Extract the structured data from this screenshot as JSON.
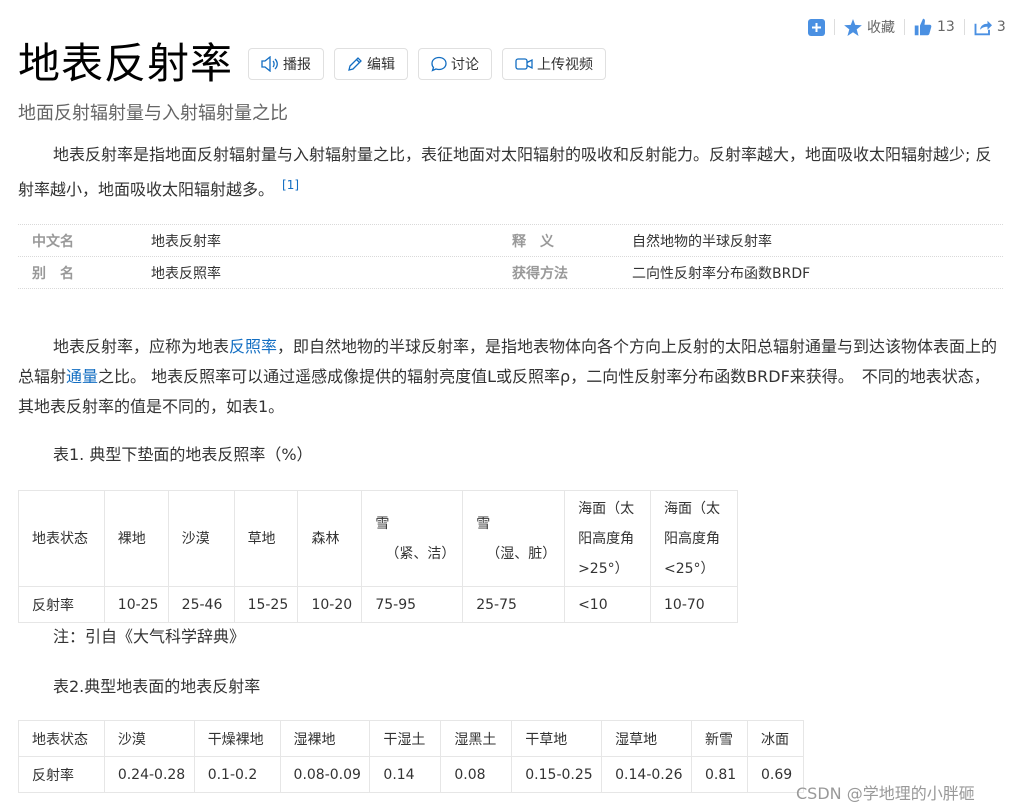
{
  "top_actions": {
    "add_icon": "plus-square-icon",
    "favorite_icon": "star-icon",
    "favorite_label": "收藏",
    "like_icon": "thumbs-up-icon",
    "like_count": "13",
    "share_icon": "share-icon",
    "share_count": "3"
  },
  "header": {
    "title": "地表反射率",
    "buttons": [
      {
        "label": "播报",
        "icon": "speaker-icon"
      },
      {
        "label": "编辑",
        "icon": "pencil-icon"
      },
      {
        "label": "讨论",
        "icon": "comment-icon"
      },
      {
        "label": "上传视频",
        "icon": "video-icon"
      }
    ]
  },
  "subtitle": "地面反射辐射量与入射辐射量之比",
  "summary": {
    "text": "地表反射率是指地面反射辐射量与入射辐射量之比，表征地面对太阳辐射的吸收和反射能力。反射率越大，地面吸收太阳辐射越少; 反射率越小，地面吸收太阳辐射越多。",
    "ref": "[1]"
  },
  "info_box": {
    "rows": [
      {
        "k1": "中文名",
        "v1": "地表反射率",
        "k2": "释　义",
        "v2": "自然地物的半球反射率"
      },
      {
        "k1": "别　名",
        "v1": "地表反照率",
        "k2": "获得方法",
        "v2": "二向性反射率分布函数BRDF"
      }
    ]
  },
  "body": {
    "p1_a": "地表反射率，应称为地表",
    "p1_link1": "反照率",
    "p1_b": "，即自然地物的半球反射率，是指地表物体向各个方向上反射的太阳总辐射通量与到达该物体表面上的总辐射",
    "p1_link2": "通量",
    "p1_c": "之比。 地表反照率可以通过遥感成像提供的辐射亮度值L或反照率ρ，二向性反射率分布函数BRDF来获得。　不同的地表状态，其地表反射率的值是不同的，如表1。"
  },
  "table1": {
    "caption": "表1. 典型下垫面的地表反照率（%）",
    "h0": "地表状态",
    "h1": "裸地",
    "h2": "沙漠",
    "h3": "草地",
    "h4": "森林",
    "h5_a": "雪",
    "h5_b": "（紧、洁）",
    "h6_a": "雪",
    "h6_b": "（湿、脏）",
    "h7_a": "海面（太",
    "h7_b": "阳高度角",
    "h7_c": ">25°）",
    "h8_a": "海面（太",
    "h8_b": "阳高度角",
    "h8_c": "<25°）",
    "row_label": "反射率",
    "values": [
      "10-25",
      "25-46",
      "15-25",
      "10-20",
      "75-95",
      "25-75",
      "<10",
      "10-70"
    ]
  },
  "note": "注：引自《大气科学辞典》",
  "table2": {
    "caption": "表2.典型地表面的地表反射率",
    "headers": [
      "地表状态",
      "沙漠",
      "干燥裸地",
      "湿裸地",
      "干湿土",
      "湿黑土",
      "干草地",
      "湿草地",
      "新雪",
      "冰面"
    ],
    "row_label": "反射率",
    "values": [
      "0.24-0.28",
      "0.1-0.2",
      "0.08-0.09",
      "0.14",
      "0.08",
      "0.15-0.25",
      "0.14-0.26",
      "0.81",
      "0.69"
    ]
  },
  "watermark": "CSDN @学地理的小胖砸",
  "colors": {
    "link": "#136ec2",
    "icon_blue": "#4a90e2",
    "border": "#e6e6e6"
  }
}
